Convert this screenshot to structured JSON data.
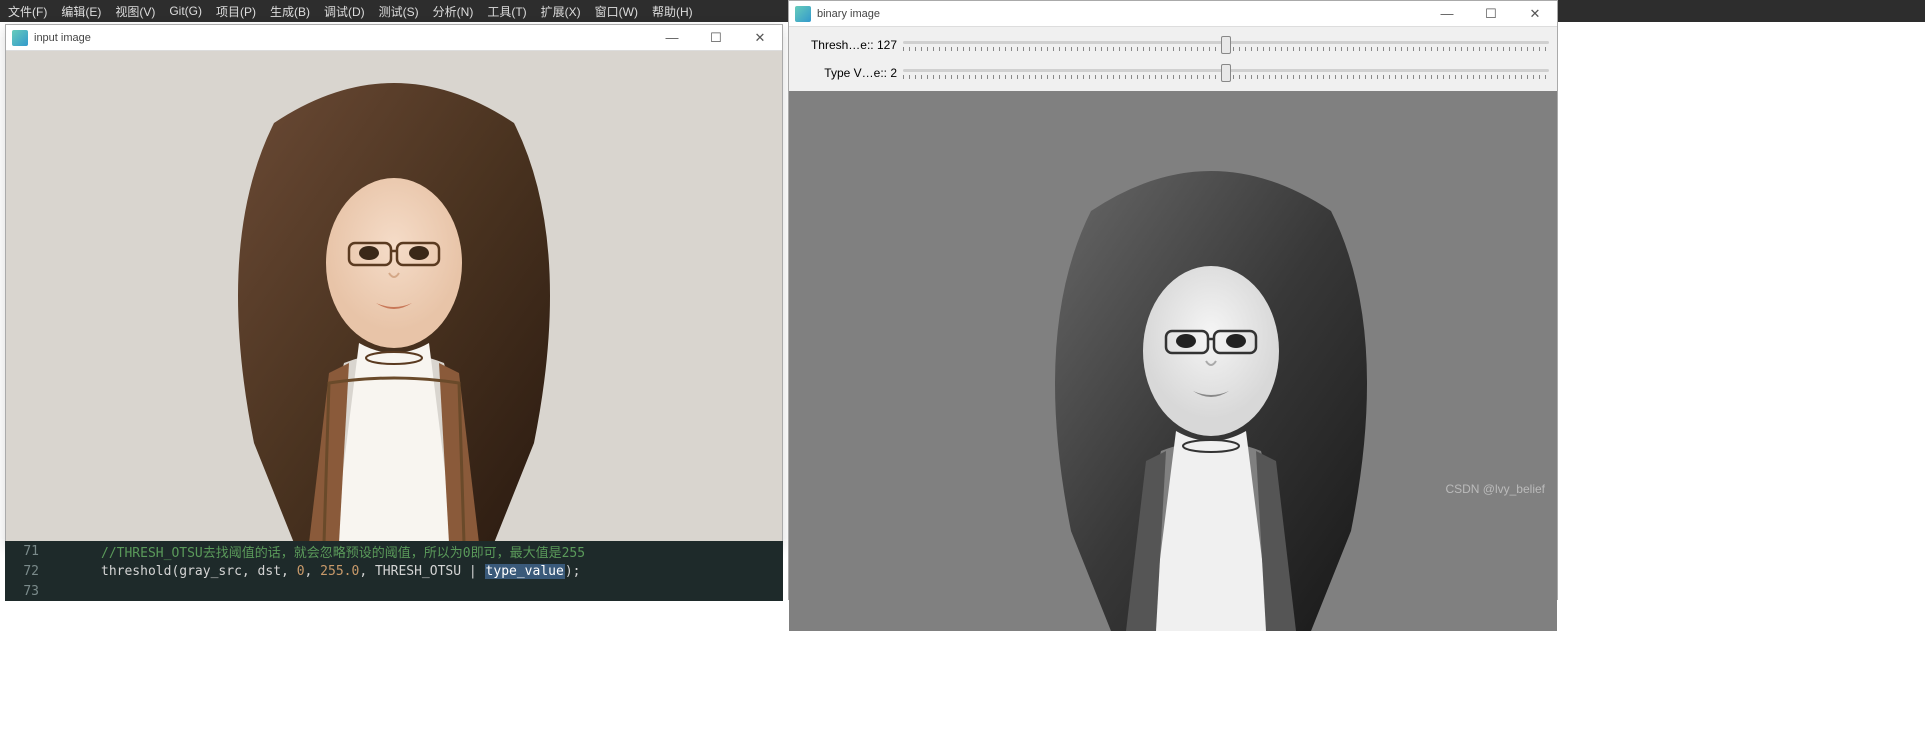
{
  "menubar": {
    "items": [
      "文件(F)",
      "编辑(E)",
      "视图(V)",
      "Git(G)",
      "项目(P)",
      "生成(B)",
      "调试(D)",
      "测试(S)",
      "分析(N)",
      "工具(T)",
      "扩展(X)",
      "窗口(W)",
      "帮助(H)"
    ]
  },
  "input_window": {
    "title": "input image",
    "controls": {
      "min": "—",
      "max": "☐",
      "close": "✕"
    }
  },
  "binary_window": {
    "title": "binary image",
    "controls": {
      "min": "—",
      "max": "☐",
      "close": "✕"
    },
    "trackbars": [
      {
        "label": "Thresh…e:: 127",
        "value": 127,
        "max": 255,
        "thumb_pct": 50
      },
      {
        "label": "Type V…e:: 2",
        "value": 2,
        "max": 4,
        "thumb_pct": 50
      }
    ]
  },
  "editor": {
    "lines": [
      {
        "num": "71",
        "active": true,
        "comment": "//THRESH_OTSU去找阈值的话，就会忽略预设的阈值，所以为0即可，最大值是255"
      },
      {
        "num": "72",
        "active": true,
        "code": {
          "fn": "threshold",
          "args_prefix": "(gray_src, dst, ",
          "n1": "0",
          "c1": ", ",
          "n2": "255.0",
          "c2": ", THRESH_OTSU | ",
          "sel": "type_value",
          "suffix": ");"
        }
      },
      {
        "num": "73",
        "active": false
      }
    ]
  },
  "watermark": "CSDN @lvy_belief"
}
